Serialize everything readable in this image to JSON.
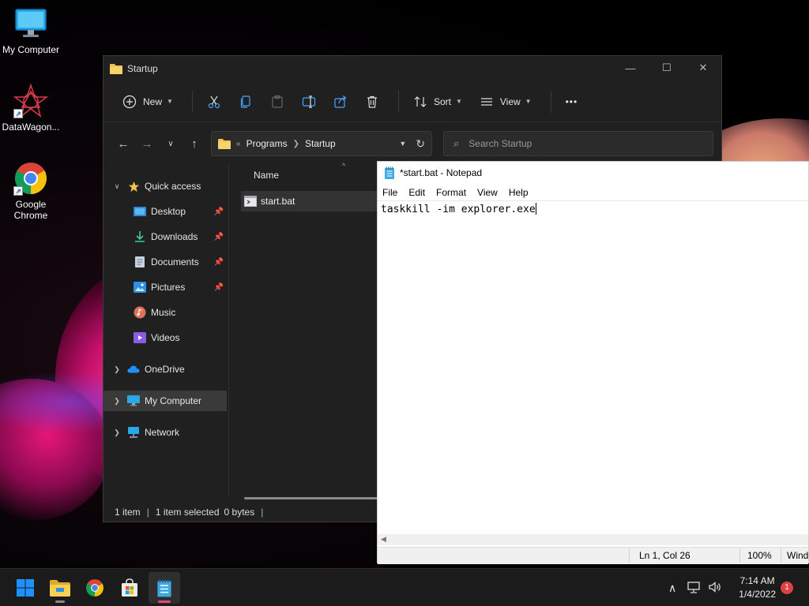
{
  "desktop": {
    "icons": [
      {
        "label": "My Computer"
      },
      {
        "label": "DataWagon..."
      },
      {
        "label": "Google Chrome"
      }
    ]
  },
  "explorer": {
    "title": "Startup",
    "toolbar": {
      "new_label": "New",
      "sort_label": "Sort",
      "view_label": "View",
      "more_label": "•••"
    },
    "breadcrumb": [
      "Programs",
      "Startup"
    ],
    "search_placeholder": "Search Startup",
    "nav": {
      "quick_access": "Quick access",
      "items": [
        {
          "label": "Desktop"
        },
        {
          "label": "Downloads"
        },
        {
          "label": "Documents"
        },
        {
          "label": "Pictures"
        },
        {
          "label": "Music"
        },
        {
          "label": "Videos"
        }
      ],
      "onedrive": "OneDrive",
      "my_computer": "My Computer",
      "network": "Network"
    },
    "list": {
      "column_name": "Name",
      "files": [
        {
          "name": "start.bat"
        }
      ]
    },
    "status": {
      "items": "1 item",
      "selected": "1 item selected",
      "size": "0 bytes"
    }
  },
  "notepad": {
    "title": "*start.bat - Notepad",
    "menu": [
      "File",
      "Edit",
      "Format",
      "View",
      "Help"
    ],
    "content": "taskkill -im explorer.exe",
    "status": {
      "position": "Ln 1, Col 26",
      "zoom": "100%",
      "eol": "Wind"
    }
  },
  "taskbar": {
    "time": "7:14 AM",
    "date": "1/4/2022",
    "notification_count": "1"
  },
  "colors": {
    "explorer_bg": "#202020",
    "folder_yellow": "#f2c14e",
    "windows_blue": "#1e90ff",
    "notepad_accent": "#e0467a"
  }
}
